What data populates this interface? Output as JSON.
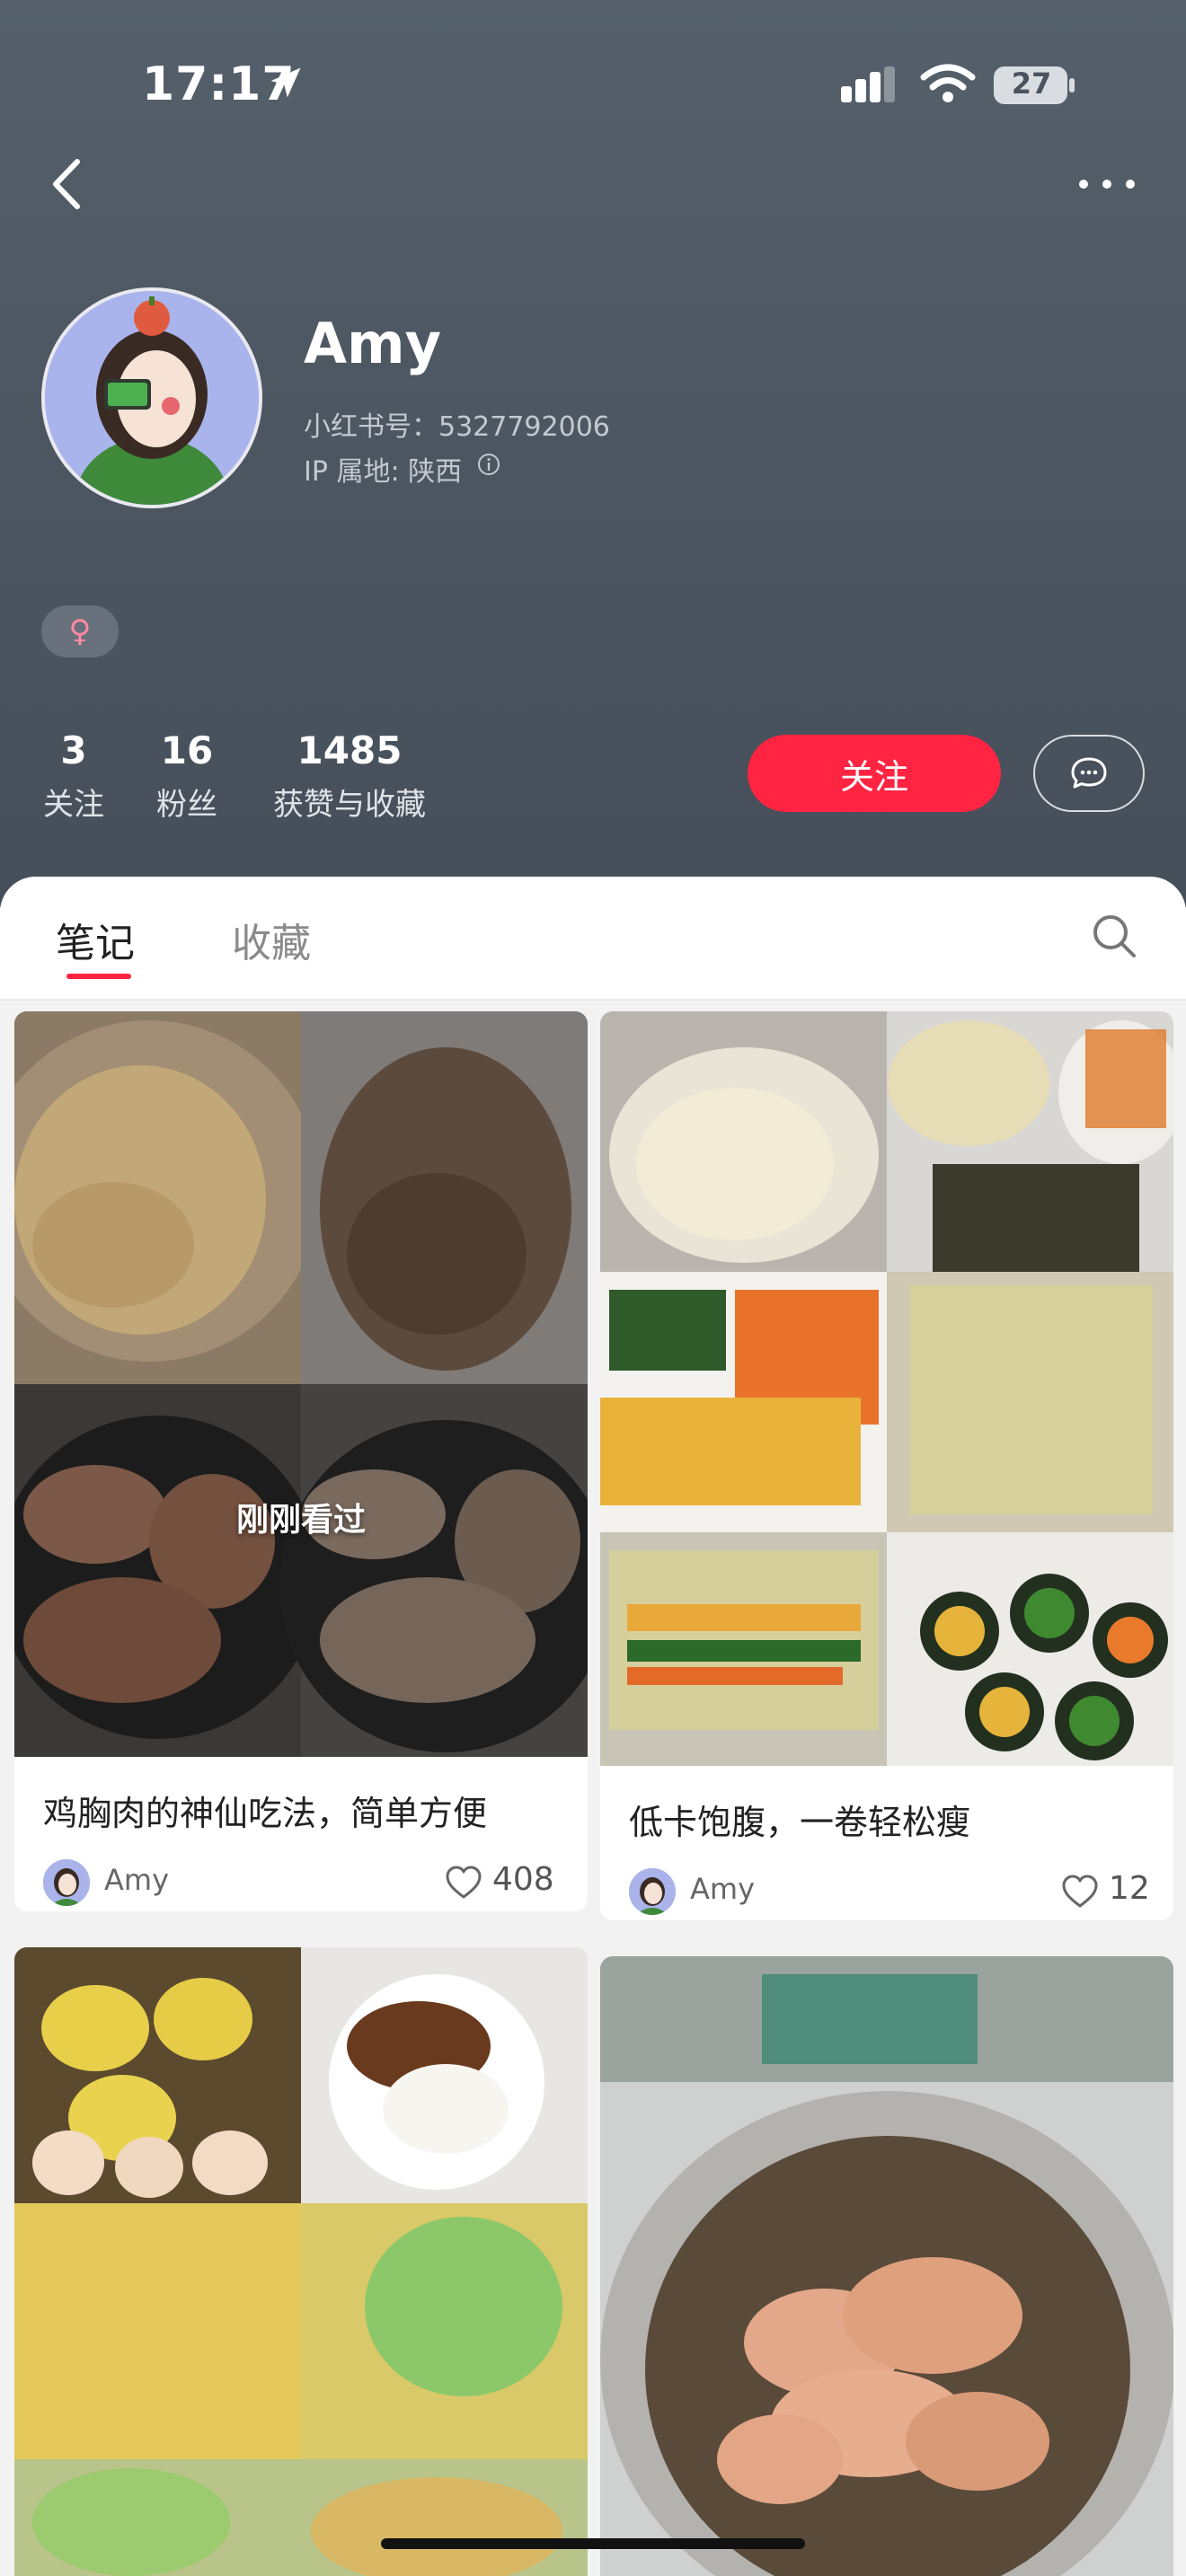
{
  "status_bar": {
    "time": "17:17",
    "battery": "27"
  },
  "profile": {
    "name": "Amy",
    "red_id": "小红书号：5327792006",
    "ip_location": "IP 属地: 陕西",
    "gender_symbol": "♀"
  },
  "stats": [
    {
      "value": "3",
      "label": "关注"
    },
    {
      "value": "16",
      "label": "粉丝"
    },
    {
      "value": "1485",
      "label": "获赞与收藏"
    }
  ],
  "actions": {
    "follow_label": "关注"
  },
  "tabs": {
    "notes": "笔记",
    "favorites": "收藏"
  },
  "notes": [
    {
      "title": "鸡胸肉的神仙吃法，简单方便",
      "author": "Amy",
      "likes": "408",
      "badge": "刚刚看过"
    },
    {
      "title": "低卡饱腹，一卷轻松瘦",
      "author": "Amy",
      "likes": "12"
    },
    {
      "title": "",
      "author": ""
    },
    {
      "title": "",
      "author": ""
    }
  ],
  "colors": {
    "accent": "#ff2442",
    "header_bg": "#4d5762"
  }
}
